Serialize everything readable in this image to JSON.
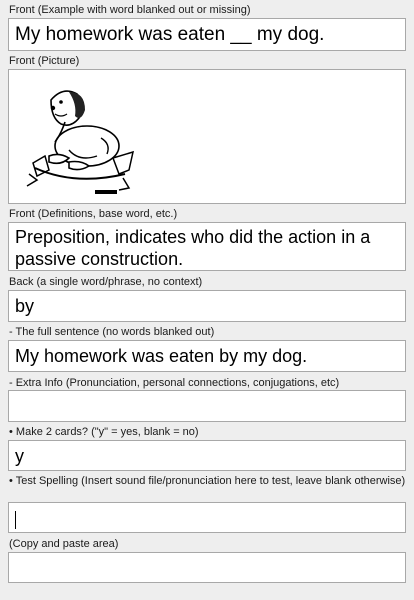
{
  "fields": {
    "front_blank": {
      "label": "Front (Example with word blanked out or missing)",
      "value": "My homework was eaten __ my dog."
    },
    "front_picture": {
      "label": "Front (Picture)",
      "image": "dog-with-torn-paper-illustration"
    },
    "front_definition": {
      "label": "Front (Definitions, base word, etc.)",
      "value": "Preposition, indicates who did the action in a passive construction."
    },
    "back": {
      "label": "Back (a single word/phrase, no context)",
      "value": "by"
    },
    "full_sentence": {
      "label": "- The full sentence (no words blanked out)",
      "value": "My homework was eaten by my dog."
    },
    "extra_info": {
      "label": "- Extra Info (Pronunciation, personal connections, conjugations, etc)",
      "value": ""
    },
    "make_two_cards": {
      "label": "• Make 2 cards? (\"y\" = yes, blank = no)",
      "value": "y"
    },
    "test_spelling": {
      "label": "• Test Spelling (Insert sound file/pronunciation here to test, leave blank otherwise)",
      "value": ""
    },
    "copy_paste": {
      "label": "(Copy and paste area)",
      "value": ""
    }
  }
}
